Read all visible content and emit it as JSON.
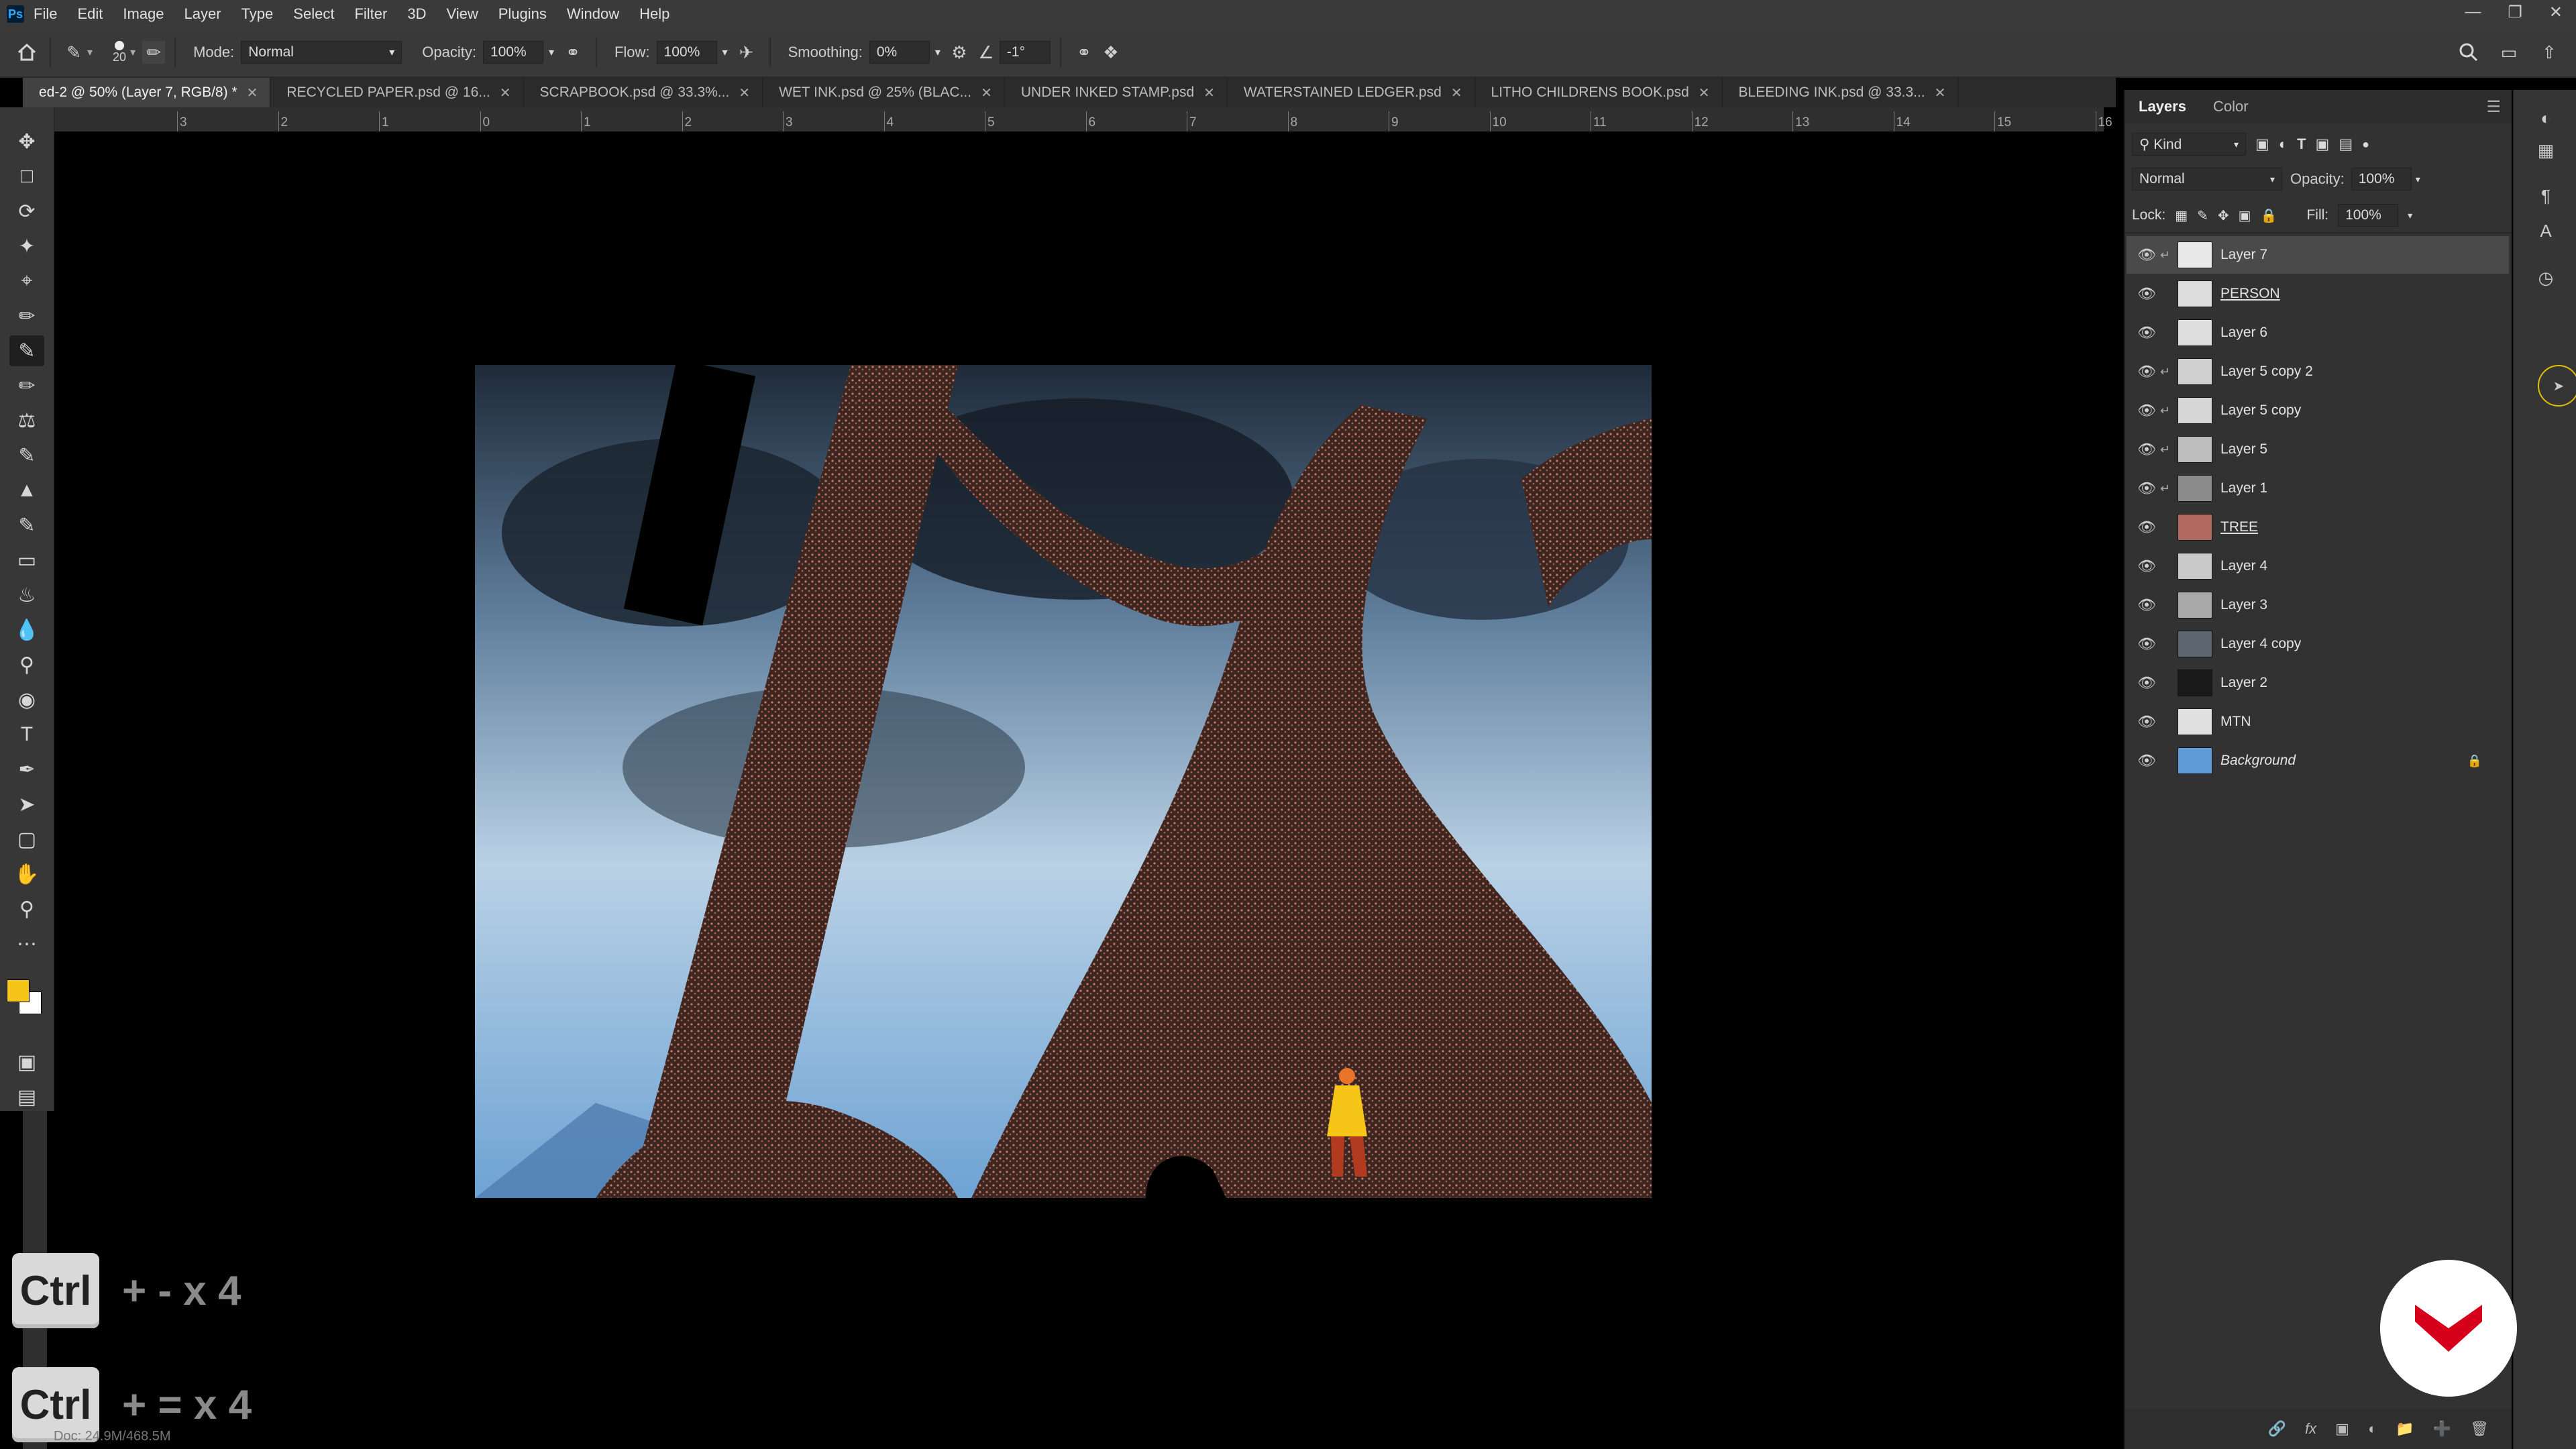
{
  "app": {
    "menu": [
      "File",
      "Edit",
      "Image",
      "Layer",
      "Type",
      "Select",
      "Filter",
      "3D",
      "View",
      "Plugins",
      "Window",
      "Help"
    ],
    "window_controls": [
      "minimize-icon",
      "restore-icon",
      "close-icon"
    ]
  },
  "options_bar": {
    "brush_size": "20",
    "mode_label": "Mode:",
    "mode_value": "Normal",
    "opacity_label": "Opacity:",
    "opacity_value": "100%",
    "flow_label": "Flow:",
    "flow_value": "100%",
    "smoothing_label": "Smoothing:",
    "smoothing_value": "0%",
    "angle_value": "-1°"
  },
  "tabs": [
    {
      "label": "ed-2 @ 50% (Layer 7, RGB/8) *",
      "active": true
    },
    {
      "label": "RECYCLED PAPER.psd @ 16..."
    },
    {
      "label": "SCRAPBOOK.psd @ 33.3%..."
    },
    {
      "label": "WET INK.psd @ 25% (BLAC..."
    },
    {
      "label": "UNDER INKED STAMP.psd"
    },
    {
      "label": "WATERSTAINED LEDGER.psd"
    },
    {
      "label": "LITHO CHILDRENS BOOK.psd"
    },
    {
      "label": "BLEEDING INK.psd @ 33.3..."
    }
  ],
  "ruler": {
    "labels": [
      "3",
      "2",
      "1",
      "0",
      "1",
      "2",
      "3",
      "4",
      "5",
      "6",
      "7",
      "8",
      "9",
      "10",
      "11",
      "12",
      "13",
      "14",
      "15",
      "16"
    ]
  },
  "panel": {
    "tabs": [
      "Layers",
      "Color"
    ],
    "filter_label": "Kind",
    "blend_mode": "Normal",
    "opacity_label": "Opacity:",
    "opacity_value": "100%",
    "lock_label": "Lock:",
    "fill_label": "Fill:",
    "fill_value": "100%",
    "layers": [
      {
        "name": "Layer 7",
        "clipped": true,
        "selected": true,
        "thumb": "#e8e8e8"
      },
      {
        "name": "PERSON",
        "underline": true,
        "thumb": "#dcdcdc"
      },
      {
        "name": "Layer 6",
        "thumb": "#dedede"
      },
      {
        "name": "Layer 5 copy 2",
        "clipped": true,
        "thumb": "#cfcfcf"
      },
      {
        "name": "Layer 5 copy",
        "clipped": true,
        "thumb": "#d6d6d6"
      },
      {
        "name": "Layer 5",
        "clipped": true,
        "thumb": "#bdbdbd"
      },
      {
        "name": "Layer 1",
        "clipped": true,
        "thumb": "#8c8c8c"
      },
      {
        "name": "TREE",
        "underline": true,
        "thumb": "#b06a5f"
      },
      {
        "name": "Layer 4",
        "thumb": "#c9c9c9"
      },
      {
        "name": "Layer 3",
        "thumb": "#a9a9a9"
      },
      {
        "name": "Layer 4 copy",
        "thumb": "#5c6670"
      },
      {
        "name": "Layer 2",
        "thumb": "#1a1a1a"
      },
      {
        "name": "MTN",
        "thumb": "#e0e0e0"
      },
      {
        "name": "Background",
        "italic": true,
        "locked": true,
        "thumb": "#5f9bd6"
      }
    ]
  },
  "overlay": {
    "key1": "Ctrl",
    "combo1": "+ - x 4",
    "key2": "Ctrl",
    "combo2": "+ = x 4"
  },
  "status": "Doc: 24.9M/468.5M",
  "colors": {
    "foreground": "#f5c518",
    "background": "#ffffff",
    "accent_logo": "#d6001c"
  }
}
